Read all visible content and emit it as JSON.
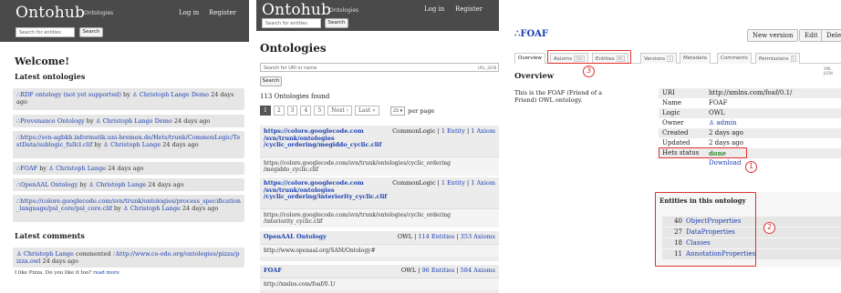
{
  "panel1": {
    "header": {
      "brand": "Ontohub",
      "nav_link": "Ontologies",
      "login": "Log in",
      "register": "Register",
      "search_placeholder": "Search for entities",
      "search_button": "Search"
    },
    "welcome": "Welcome!",
    "latest_ontologies_title": "Latest ontologies",
    "ontologies": [
      {
        "link": "∴RDF ontology (not yet supported)",
        "by": "by",
        "author": "♙ Christoph Lange Demo",
        "time": "24 days ago"
      },
      {
        "link": "∴Provenance Ontology",
        "by": "by",
        "author": "♙ Christoph Lange Demo",
        "time": "24 days ago"
      },
      {
        "link": "∴https://svn-agbkb.informatik.uni-bremen.de/Hets/trunk/CommonLogic/TestData/sublogic_fullcl.clif",
        "by": "by",
        "author": "♙ Christoph Lange",
        "time": "24 days ago"
      },
      {
        "link": "∴FOAF",
        "by": "by",
        "author": "♙ Christoph Lange",
        "time": "24 days ago"
      },
      {
        "link": "∴OpenAAL Ontology",
        "by": "by",
        "author": "♙ Christoph Lange",
        "time": "24 days ago"
      },
      {
        "link": "∴https://colore.googlecode.com/svn/trunk/ontologies/process_specification_language/psl_core/psl_core.clif",
        "by": "by",
        "author": "♙ Christoph Lange",
        "time": "24 days ago"
      }
    ],
    "latest_comments_title": "Latest comments",
    "comment": {
      "author": "♙ Christoph Lange",
      "verb": "commented",
      "link": "∴http://www.co-ode.org/ontologies/pizza/pizza.owl",
      "time": "24 days ago",
      "text": "I like Pizza. Do you like it too?",
      "read_more": "read more"
    }
  },
  "panel2": {
    "header": {
      "brand": "Ontohub",
      "nav_link": "Ontologies",
      "login": "Log in",
      "register": "Register",
      "search_placeholder": "Search for entities",
      "search_button": "Search"
    },
    "title": "Ontologies",
    "search_placeholder": "Search for URI or name",
    "search_hint": "URL, JSON",
    "search_button": "Search",
    "found_text": "113 Ontologies found",
    "pagination": [
      "1",
      "2",
      "3",
      "4",
      "5",
      "Next ›",
      "Last »"
    ],
    "per_page_value": "25",
    "per_page_label": "per page",
    "ontologies": [
      {
        "name": "https://colore.googlecode.com/svn/trunk/ontologies/cyclic_ordering/megiddo_cyclic.clif",
        "name_lines": [
          "https://colore.googlecode.com",
          "/svn/trunk/ontologies",
          "/cyclic_ordering/megiddo_cyclic.clif"
        ],
        "logic": "CommonLogic",
        "entities": "1 Entity",
        "axioms": "1 Axiom",
        "url_lines": [
          "https://colore.googlecode.com/svn/trunk/ontologies/cyclic_ordering",
          "/megiddo_cyclic.clif"
        ]
      },
      {
        "name": "https://colore.googlecode.com/svn/trunk/ontologies/cyclic_ordering/interiority_cyclic.clif",
        "name_lines": [
          "https://colore.googlecode.com",
          "/svn/trunk/ontologies",
          "/cyclic_ordering/interiority_cyclic.clif"
        ],
        "logic": "CommonLogic",
        "entities": "1 Entity",
        "axioms": "1 Axiom",
        "url_lines": [
          "https://colore.googlecode.com/svn/trunk/ontologies/cyclic_ordering",
          "/interiority_cyclic.clif"
        ]
      },
      {
        "name": "OpenAAL Ontology",
        "name_lines": [
          "OpenAAL Ontology"
        ],
        "logic": "OWL",
        "entities": "114 Entities",
        "axioms": "353 Axioms",
        "url_lines": [
          "http://www.openaal.org/SAM/Ontology#"
        ]
      },
      {
        "name": "FOAF",
        "name_lines": [
          "FOAF"
        ],
        "logic": "OWL",
        "entities": "96 Entities",
        "axioms": "584 Axioms",
        "url_lines": [
          "http://xmlns.com/foaf/0.1/"
        ]
      }
    ]
  },
  "panel3": {
    "title": "∴FOAF",
    "actions": [
      "New version",
      "Edit",
      "Delete"
    ],
    "tabs": [
      {
        "label": "Overview",
        "count": ""
      },
      {
        "label": "Axioms",
        "count": "584"
      },
      {
        "label": "Entities",
        "count": "96"
      },
      {
        "label": "Versions",
        "count": "1"
      },
      {
        "label": "Metadata",
        "count": ""
      },
      {
        "label": "Comments",
        "count": ""
      },
      {
        "label": "Permissions",
        "count": "1"
      }
    ],
    "overview_title": "Overview",
    "overview_hint": "XML JSON",
    "description": "This is the FOAF (Friend of a Friend) OWL ontology.",
    "info": [
      {
        "key": "URI",
        "value": "http://xmlns.com/foaf/0.1/"
      },
      {
        "key": "Name",
        "value": "FOAF"
      },
      {
        "key": "Logic",
        "value": "OWL"
      },
      {
        "key": "Owner",
        "value": "♙ admin"
      },
      {
        "key": "Created",
        "value": "2 days ago"
      },
      {
        "key": "Updated",
        "value": "2 days ago"
      },
      {
        "key": "Hets status",
        "value": "done"
      },
      {
        "key": "",
        "value": "Download"
      }
    ],
    "entities_title": "Entities in this ontology",
    "entities": [
      {
        "count": "40",
        "label": "ObjectProperties"
      },
      {
        "count": "27",
        "label": "DataProperties"
      },
      {
        "count": "18",
        "label": "Classes"
      },
      {
        "count": "11",
        "label": "AnnotationProperties"
      }
    ],
    "markers": [
      "1",
      "2",
      "3"
    ],
    "colors": {
      "marker": "#e03030",
      "done": "#2e8b2e",
      "link": "#1a3fb0"
    }
  }
}
